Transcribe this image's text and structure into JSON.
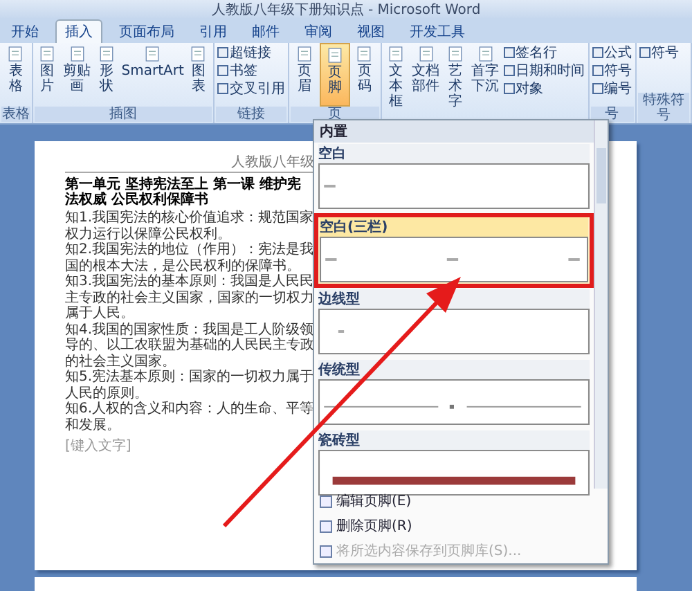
{
  "window": {
    "title": "人教版八年级下册知识点 - Microsoft Word"
  },
  "tabs": [
    {
      "label": "开始",
      "selected": false
    },
    {
      "label": "插入",
      "selected": true
    },
    {
      "label": "页面布局",
      "selected": false
    },
    {
      "label": "引用",
      "selected": false
    },
    {
      "label": "邮件",
      "selected": false
    },
    {
      "label": "审阅",
      "selected": false
    },
    {
      "label": "视图",
      "selected": false
    },
    {
      "label": "开发工具",
      "selected": false
    }
  ],
  "ribbon": {
    "groups": [
      {
        "label": "表格",
        "buttons": [
          {
            "label": "表格",
            "kind": "large",
            "selected": false
          }
        ]
      },
      {
        "label": "插图",
        "buttons": [
          {
            "label": "图片",
            "kind": "large",
            "selected": false
          },
          {
            "label": "剪贴画",
            "kind": "large",
            "selected": false
          },
          {
            "label": "形状",
            "kind": "large",
            "selected": false
          },
          {
            "label": "SmartArt",
            "kind": "large",
            "selected": false
          },
          {
            "label": "图表",
            "kind": "large",
            "selected": false
          }
        ]
      },
      {
        "label": "链接",
        "buttons": [
          {
            "label": "超链接",
            "kind": "small",
            "selected": false
          },
          {
            "label": "书签",
            "kind": "small",
            "selected": false
          },
          {
            "label": "交叉引用",
            "kind": "small",
            "selected": false
          }
        ]
      },
      {
        "label": "页",
        "buttons": [
          {
            "label": "页眉",
            "kind": "large",
            "selected": false
          },
          {
            "label": "页脚",
            "kind": "large",
            "selected": true
          },
          {
            "label": "页码",
            "kind": "large",
            "selected": false
          }
        ]
      },
      {
        "buttons": [
          {
            "label": "文本框",
            "kind": "large",
            "selected": false
          },
          {
            "label": "文档部件",
            "kind": "large",
            "selected": false
          },
          {
            "label": "艺术字",
            "kind": "large",
            "selected": false
          },
          {
            "label": "首字下沉",
            "kind": "large",
            "selected": false
          },
          {
            "label": "签名行",
            "kind": "small",
            "selected": false
          },
          {
            "label": "日期和时间",
            "kind": "small",
            "selected": false
          },
          {
            "label": "对象",
            "kind": "small",
            "selected": false
          }
        ]
      },
      {
        "label": "号",
        "buttons": [
          {
            "label": "公式",
            "kind": "small",
            "selected": false
          },
          {
            "label": "符号",
            "kind": "small",
            "selected": false
          },
          {
            "label": "编号",
            "kind": "small",
            "selected": false
          }
        ]
      },
      {
        "label": "特殊符号",
        "buttons": [
          {
            "label": "符号",
            "kind": "small",
            "selected": false
          }
        ]
      }
    ]
  },
  "document": {
    "header": "人教版八年级",
    "heading": "第一单元 坚持宪法至上 第一课 维护宪法权威 公民权利保障书",
    "paragraphs": [
      "知1.我国宪法的核心价值追求：规范国家权力运行以保障公民权利。",
      "知2.我国宪法的地位（作用）：宪法是我国的根本大法，是公民权利的保障书。",
      "知3.我国宪法的基本原则：我国是人民民主专政的社会主义国家，国家的一切权力属于人民。",
      "知4.我国的国家性质：我国是工人阶级领导的、以工农联盟为基础的人民民主专政的社会主义国家。",
      "知5.宪法基本原则：国家的一切权力属于人民的原则。",
      "知6.人权的含义和内容：人的生命、平等和发展。"
    ],
    "footer": "[键入文字]"
  },
  "footer_gallery": {
    "header": "内置",
    "items": [
      {
        "label": "空白",
        "kind": "blank",
        "selected": false
      },
      {
        "label": "空白(三栏)",
        "kind": "three_column",
        "selected": true
      },
      {
        "label": "边线型",
        "kind": "line",
        "selected": false
      },
      {
        "label": "传统型",
        "kind": "traditional",
        "selected": false
      },
      {
        "label": "瓷砖型",
        "kind": "tile",
        "selected": false
      }
    ],
    "commands": [
      {
        "label": "编辑页脚(E)",
        "disabled": false
      },
      {
        "label": "删除页脚(R)",
        "disabled": false
      },
      {
        "label": "将所选内容保存到页脚库(S)...",
        "disabled": true
      }
    ]
  }
}
